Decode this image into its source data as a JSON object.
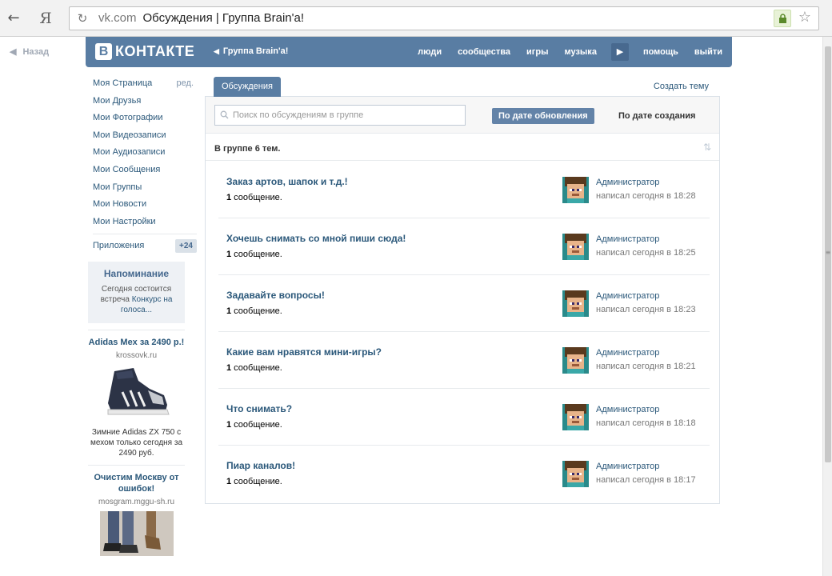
{
  "browser": {
    "yandex_glyph": "Я",
    "url_domain": "vk.com",
    "url_title": "Обсуждения | Группа Brain'a!"
  },
  "page": {
    "back_label": "Назад"
  },
  "header": {
    "logo_letter": "В",
    "logo_text": "КОНТАКТЕ",
    "group_back": "Группа Brain'a!",
    "menu": [
      "люди",
      "сообщества",
      "игры",
      "музыка",
      "помощь",
      "выйти"
    ]
  },
  "sidebar": {
    "edit_label": "ред.",
    "items": [
      "Моя Страница",
      "Мои Друзья",
      "Мои Фотографии",
      "Мои Видеозаписи",
      "Мои Аудиозаписи",
      "Мои Сообщения",
      "Мои Группы",
      "Мои Новости",
      "Мои Настройки"
    ],
    "apps_label": "Приложения",
    "apps_badge": "+24",
    "reminder": {
      "title": "Напоминание",
      "text_before": "Сегодня состоится встреча ",
      "text_link": "Конкурс на голоса..."
    },
    "ads": [
      {
        "title": "Adidas Mex за 2490 р.!",
        "domain": "krossovk.ru",
        "text": "Зимние Adidas ZX 750 с мехом только сегодня за 2490 руб."
      },
      {
        "title": "Очистим Москву от ошибок!",
        "domain": "mosgram.mggu-sh.ru",
        "text": ""
      }
    ]
  },
  "main": {
    "tab_label": "Обсуждения",
    "create_topic": "Создать тему",
    "search_placeholder": "Поиск по обсуждениям в группе",
    "sort_active": "По дате обновления",
    "sort_other": "По дате создания",
    "count_text": "В группе 6 тем.",
    "topics": [
      {
        "title": "Заказ артов, шапок и т.д.!",
        "count": "1",
        "count_label": " сообщение.",
        "author": "Администратор",
        "when": "написал сегодня в 18:28"
      },
      {
        "title": "Хочешь снимать со мной пиши сюда!",
        "count": "1",
        "count_label": " сообщение.",
        "author": "Администратор",
        "when": "написал сегодня в 18:25"
      },
      {
        "title": "Задавайте вопросы!",
        "count": "1",
        "count_label": " сообщение.",
        "author": "Администратор",
        "when": "написал сегодня в 18:23"
      },
      {
        "title": "Какие вам нравятся мини-игры?",
        "count": "1",
        "count_label": " сообщение.",
        "author": "Администратор",
        "when": "написал сегодня в 18:21"
      },
      {
        "title": "Что снимать?",
        "count": "1",
        "count_label": " сообщение.",
        "author": "Администратор",
        "when": "написал сегодня в 18:18"
      },
      {
        "title": "Пиар каналов!",
        "count": "1",
        "count_label": " сообщение.",
        "author": "Администратор",
        "when": "написал сегодня в 18:17"
      }
    ]
  },
  "colors": {
    "header_bg": "#597da3",
    "link": "#2b587a",
    "accent_button": "#6383a8"
  }
}
